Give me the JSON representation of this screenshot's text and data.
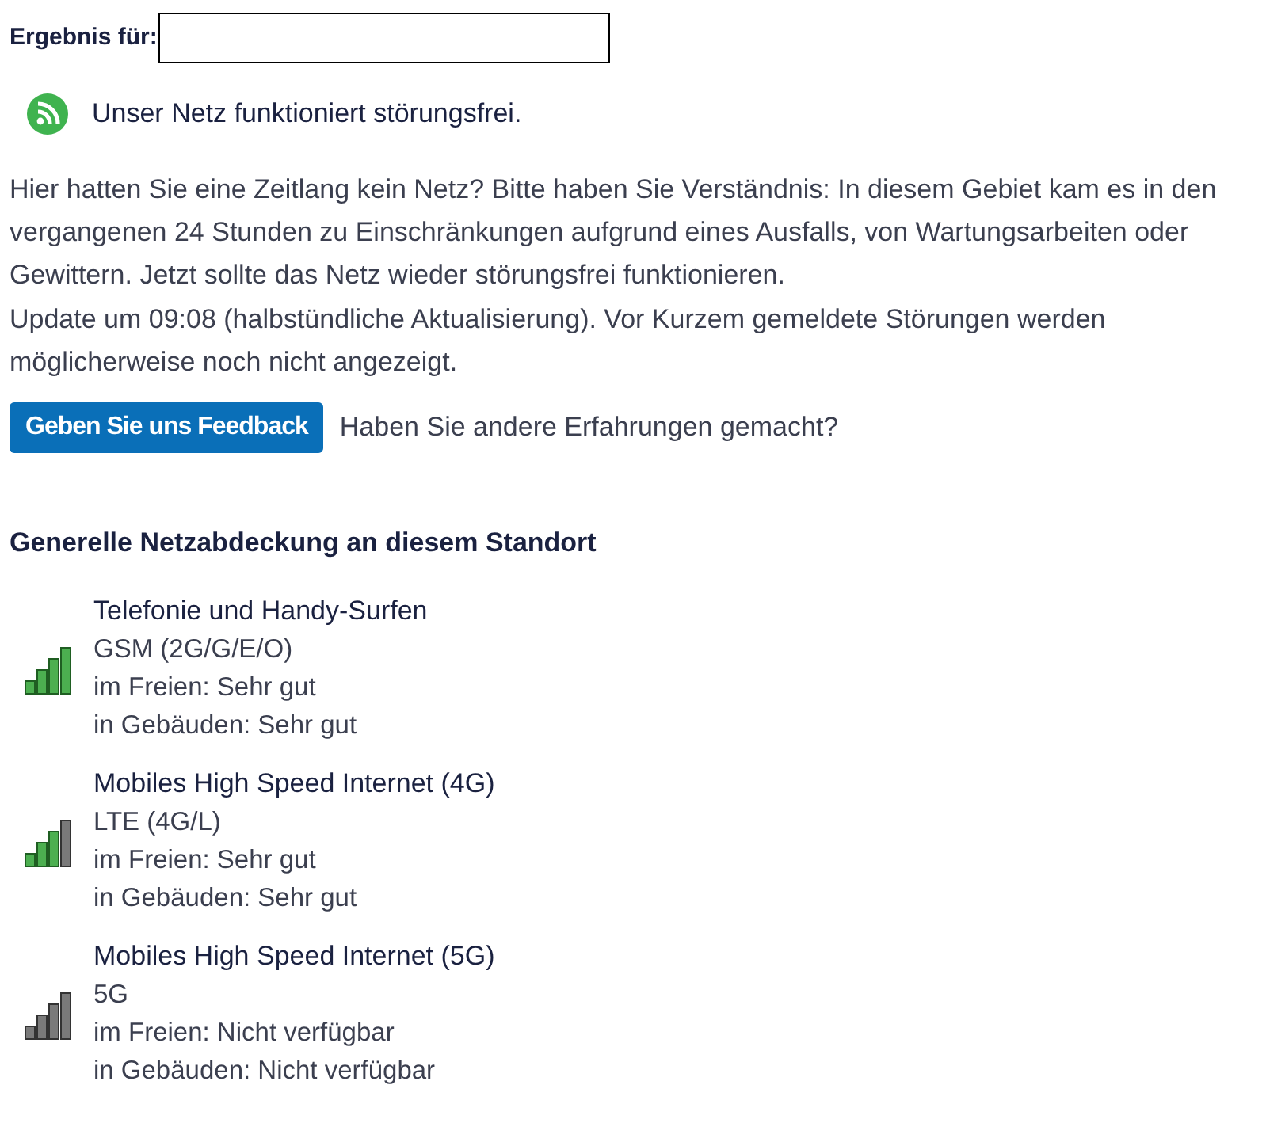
{
  "result": {
    "label": "Ergebnis für:"
  },
  "status": {
    "text": "Unser Netz funktioniert störungsfrei."
  },
  "info": {
    "paragraphs": [
      "Hier hatten Sie eine Zeitlang kein Netz? Bitte haben Sie Verständnis: In diesem Gebiet kam es in den vergangenen 24 Stunden zu Einschränkungen aufgrund eines Ausfalls, von Wartungsarbeiten oder Gewittern. Jetzt sollte das Netz wieder störungsfrei funktionieren.",
      "Update um 09:08 (halbstündliche Aktualisierung). Vor Kurzem gemeldete Störungen werden möglicherweise noch nicht angezeigt."
    ]
  },
  "feedback": {
    "button": "Geben Sie uns Feedback",
    "text": "Haben Sie andere Erfahrungen gemacht?"
  },
  "coverage": {
    "heading": "Generelle Netzabdeckung an diesem Standort",
    "items": [
      {
        "title": "Telefonie und Handy-Surfen",
        "technology": "GSM (2G/G/E/O)",
        "outdoor": "im Freien: Sehr gut",
        "indoor": "in Gebäuden: Sehr gut",
        "kind": "full"
      },
      {
        "title": "Mobiles High Speed Internet (4G)",
        "technology": "LTE (4G/L)",
        "outdoor": "im Freien: Sehr gut",
        "indoor": "in Gebäuden: Sehr gut",
        "kind": "partial"
      },
      {
        "title": "Mobiles High Speed Internet (5G)",
        "technology": "5G",
        "outdoor": "im Freien: Nicht verfügbar",
        "indoor": "in Gebäuden: Nicht verfügbar",
        "kind": "empty"
      }
    ]
  }
}
